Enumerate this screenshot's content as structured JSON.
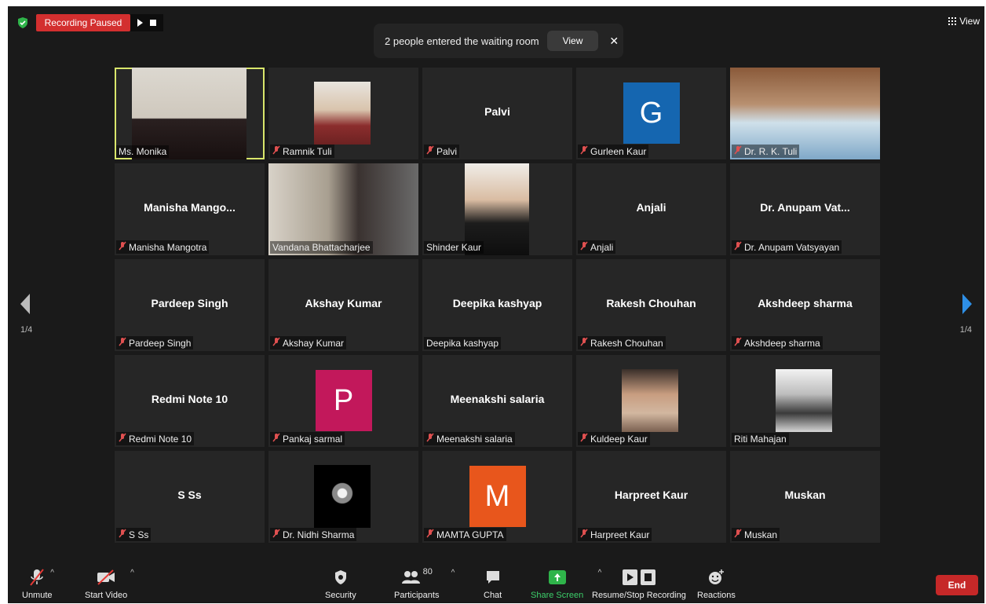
{
  "top_bar": {
    "recording_label": "Recording Paused",
    "view_label": "View"
  },
  "notification": {
    "text": "2 people entered the waiting room",
    "view_button": "View",
    "close": "✕"
  },
  "pager": {
    "left": "1/4",
    "right": "1/4"
  },
  "tiles": [
    {
      "name": "Ms. Monika",
      "center": "",
      "muted": false,
      "type": "video",
      "active": true
    },
    {
      "name": "Ramnik Tuli",
      "center": "",
      "muted": true,
      "type": "photo"
    },
    {
      "name": "Palvi",
      "center": "Palvi",
      "muted": true,
      "type": "name"
    },
    {
      "name": "Gurleen Kaur",
      "center": "",
      "muted": true,
      "type": "avatar",
      "letter": "G",
      "color": "#1566b0"
    },
    {
      "name": "Dr. R. K. Tuli",
      "center": "",
      "muted": true,
      "type": "video"
    },
    {
      "name": "Manisha Mangotra",
      "center": "Manisha  Mango...",
      "muted": true,
      "type": "name"
    },
    {
      "name": "Vandana Bhattacharjee",
      "center": "",
      "muted": false,
      "type": "video"
    },
    {
      "name": "Shinder Kaur",
      "center": "",
      "muted": false,
      "type": "photo"
    },
    {
      "name": "Anjali",
      "center": "Anjali",
      "muted": true,
      "type": "name"
    },
    {
      "name": "Dr. Anupam Vatsyayan",
      "center": "Dr. Anupam Vat...",
      "muted": true,
      "type": "name"
    },
    {
      "name": "Pardeep Singh",
      "center": "Pardeep Singh",
      "muted": true,
      "type": "name"
    },
    {
      "name": "Akshay Kumar",
      "center": "Akshay Kumar",
      "muted": true,
      "type": "name"
    },
    {
      "name": "Deepika kashyap",
      "center": "Deepika kashyap",
      "muted": false,
      "type": "name"
    },
    {
      "name": "Rakesh Chouhan",
      "center": "Rakesh Chouhan",
      "muted": true,
      "type": "name"
    },
    {
      "name": "Akshdeep sharma",
      "center": "Akshdeep sharma",
      "muted": true,
      "type": "name"
    },
    {
      "name": "Redmi Note 10",
      "center": "Redmi Note 10",
      "muted": true,
      "type": "name"
    },
    {
      "name": "Pankaj sarmal",
      "center": "",
      "muted": true,
      "type": "avatar",
      "letter": "P",
      "color": "#c2185b"
    },
    {
      "name": "Meenakshi salaria",
      "center": "Meenakshi salaria",
      "muted": true,
      "type": "name"
    },
    {
      "name": "Kuldeep Kaur",
      "center": "",
      "muted": true,
      "type": "photo"
    },
    {
      "name": "Riti Mahajan",
      "center": "",
      "muted": false,
      "type": "photo"
    },
    {
      "name": "S Ss",
      "center": "S Ss",
      "muted": true,
      "type": "name"
    },
    {
      "name": "Dr. Nidhi Sharma",
      "center": "",
      "muted": true,
      "type": "photo"
    },
    {
      "name": "MAMTA GUPTA",
      "center": "",
      "muted": true,
      "type": "avatar",
      "letter": "M",
      "color": "#e8561c"
    },
    {
      "name": "Harpreet Kaur",
      "center": "Harpreet Kaur",
      "muted": true,
      "type": "name"
    },
    {
      "name": "Muskan",
      "center": "Muskan",
      "muted": true,
      "type": "name"
    }
  ],
  "toolbar": {
    "unmute": "Unmute",
    "start_video": "Start Video",
    "security": "Security",
    "participants": "Participants",
    "participants_count": "80",
    "chat": "Chat",
    "share_screen": "Share Screen",
    "recording": "Resume/Stop Recording",
    "reactions": "Reactions",
    "end": "End"
  }
}
